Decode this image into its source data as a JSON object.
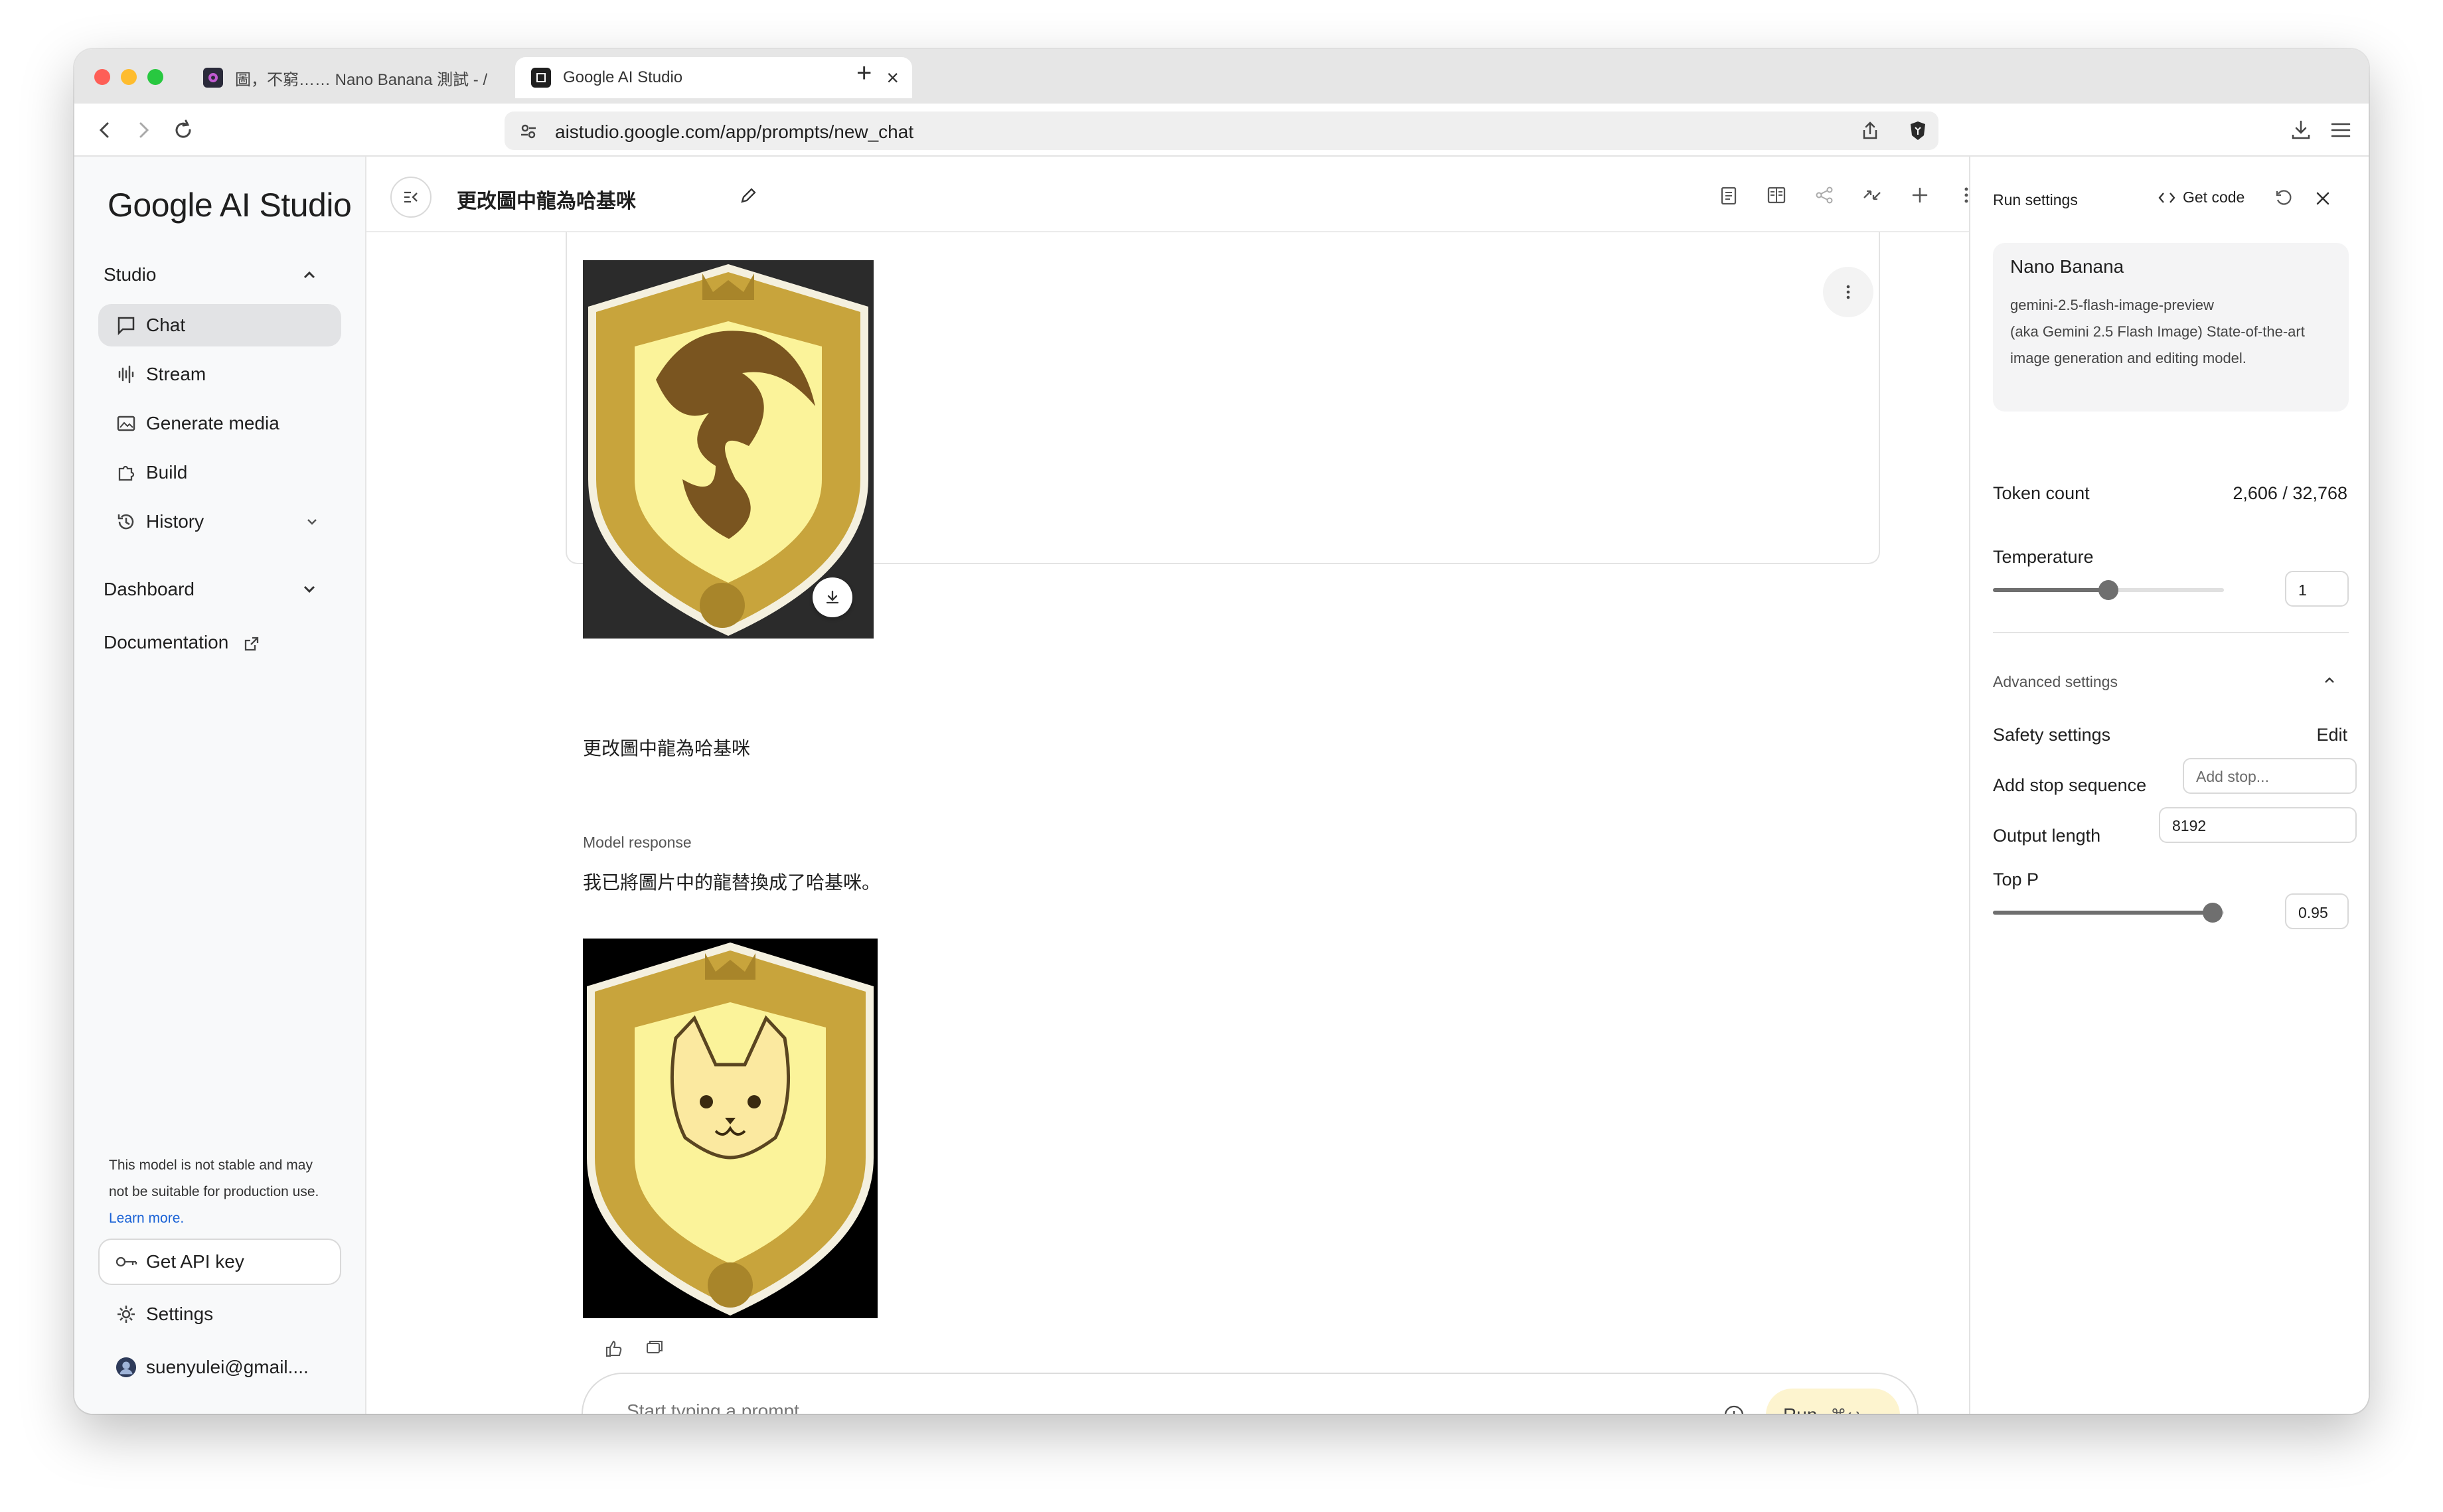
{
  "browser": {
    "tabs": [
      {
        "title": "圖，不窮…… Nano Banana 測試 - /"
      },
      {
        "title": "Google AI Studio"
      }
    ],
    "new_tab_symbol": "+",
    "close_symbol": "×",
    "url": "aistudio.google.com/app/prompts/new_chat"
  },
  "sidebar": {
    "brand": "Google AI Studio",
    "studio_label": "Studio",
    "items": [
      {
        "label": "Chat",
        "icon": "chat-icon",
        "active": true
      },
      {
        "label": "Stream",
        "icon": "waveform-icon"
      },
      {
        "label": "Generate media",
        "icon": "image-icon"
      },
      {
        "label": "Build",
        "icon": "puzzle-icon"
      },
      {
        "label": "History",
        "icon": "history-icon"
      }
    ],
    "dashboard_label": "Dashboard",
    "documentation_label": "Documentation",
    "disclaimer": "This model is not stable and may not be suitable for production use.",
    "learn_more": "Learn more.",
    "api_key_label": "Get API key",
    "settings_label": "Settings",
    "account": "suenyulei@gmail...."
  },
  "main": {
    "title": "更改圖中龍為哈基咪",
    "user_message": "更改圖中龍為哈基咪",
    "response_label": "Model response",
    "response_text": "我已將圖片中的龍替換成了哈基咪。",
    "prompt_placeholder": "Start typing a prompt",
    "run_label": "Run",
    "run_shortcut": "⌘↩"
  },
  "run_settings": {
    "title": "Run settings",
    "get_code": "Get code",
    "model": {
      "name": "Nano Banana",
      "id": "gemini-2.5-flash-image-preview",
      "description": "(aka Gemini 2.5 Flash Image) State-of-the-art image generation and editing model."
    },
    "token_count_label": "Token count",
    "token_count_value": "2,606 / 32,768",
    "temperature_label": "Temperature",
    "temperature_value": "1",
    "temperature_fraction": 0.5,
    "advanced_label": "Advanced settings",
    "safety_label": "Safety settings",
    "safety_edit": "Edit",
    "stop_label": "Add stop sequence",
    "stop_placeholder": "Add stop...",
    "output_length_label": "Output length",
    "output_length_value": "8192",
    "top_p_label": "Top P",
    "top_p_value": "0.95",
    "top_p_fraction": 0.95
  },
  "colors": {
    "accent_run": "#fdf4cf",
    "link": "#1a62d6",
    "shield_gold": "#c8a43c",
    "shield_inner": "#fbf39a"
  }
}
